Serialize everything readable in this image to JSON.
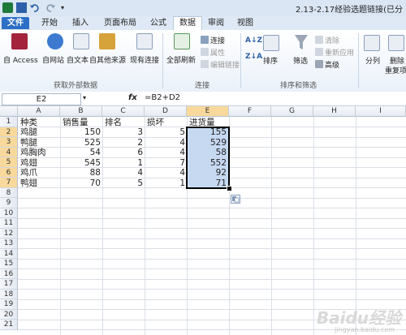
{
  "window": {
    "title": "2.13-2.17经验选题链接(已分"
  },
  "tabs": [
    "文件",
    "开始",
    "插入",
    "页面布局",
    "公式",
    "数据",
    "审阅",
    "视图"
  ],
  "ribbon": {
    "external": {
      "access": "自 Access",
      "web": "自网站",
      "text": "自文本",
      "other": "自其他来源",
      "existing": "现有连接",
      "group": "获取外部数据"
    },
    "connections": {
      "refresh": "全部刷新",
      "connections": "连接",
      "properties": "属性",
      "edit_links": "编辑链接",
      "group": "连接"
    },
    "sort": {
      "sort": "排序",
      "filter": "筛选",
      "clear": "清除",
      "reapply": "重新应用",
      "advanced": "高级",
      "group": "排序和筛选"
    },
    "tools": {
      "split": "分列",
      "remove": "删除",
      "remove2": "重复项"
    },
    "colors": {
      "file_tab": "#2c6fc4",
      "selection": "#c6d9f1",
      "header_selected": "#f9d99b"
    }
  },
  "formula_bar": {
    "name_box": "E2",
    "fx": "fx",
    "formula": "=B2+D2"
  },
  "sheet": {
    "columns": [
      "A",
      "B",
      "C",
      "D",
      "E",
      "F",
      "G",
      "H",
      "I"
    ],
    "rows": [
      "1",
      "2",
      "3",
      "4",
      "5",
      "6",
      "7",
      "8",
      "9",
      "10",
      "11",
      "12",
      "13",
      "14",
      "15",
      "16",
      "17",
      "18",
      "19",
      "20",
      "21"
    ],
    "headers": {
      "a": "种类",
      "b": "销售量",
      "c": "排名",
      "d": "损坏",
      "e": "进货量"
    },
    "data": [
      {
        "a": "鸡腿",
        "b": "150",
        "c": "3",
        "d": "5",
        "e": "155"
      },
      {
        "a": "鸭腿",
        "b": "525",
        "c": "2",
        "d": "4",
        "e": "529"
      },
      {
        "a": "鸡胸肉",
        "b": "54",
        "c": "6",
        "d": "4",
        "e": "58"
      },
      {
        "a": "鸡翅",
        "b": "545",
        "c": "1",
        "d": "7",
        "e": "552"
      },
      {
        "a": "鸡爪",
        "b": "88",
        "c": "4",
        "d": "4",
        "e": "92"
      },
      {
        "a": "鸭翅",
        "b": "70",
        "c": "5",
        "d": "1",
        "e": "71"
      }
    ]
  },
  "watermark": {
    "text": "Baidu经验",
    "url": "jingyan.baidu.com"
  }
}
